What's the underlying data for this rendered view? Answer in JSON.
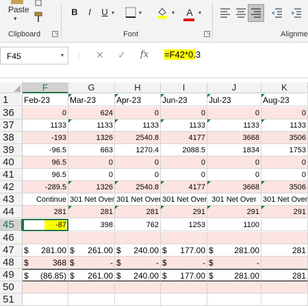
{
  "ribbon": {
    "paste_label": "Paste",
    "clipboard_label": "Clipboard",
    "font_label": "Font",
    "alignment_label": "Alignme",
    "bold": "B",
    "italic": "I",
    "underline": "U",
    "font_color_letter": "A"
  },
  "formula_bar": {
    "name_box": "F45",
    "formula_highlight": "=F42*0.",
    "formula_rest": "3",
    "fx": "fx"
  },
  "columns": [
    "F",
    "G",
    "H",
    "I",
    "J",
    "K"
  ],
  "active_column": "F",
  "rows": [
    {
      "num": "1",
      "cells": [
        "Feb-23",
        "Mar-23",
        "Apr-23",
        "Jun-23",
        "Jul-23",
        "Aug-23"
      ]
    },
    {
      "num": "36",
      "cells": [
        "0",
        "624",
        "0",
        "0",
        "0",
        "0"
      ]
    },
    {
      "num": "37",
      "cells": [
        "1133",
        "1133",
        "1133",
        "1133",
        "1133",
        "1133"
      ]
    },
    {
      "num": "38",
      "cells": [
        "-193",
        "1326",
        "2540.8",
        "4177",
        "3668",
        "3506"
      ]
    },
    {
      "num": "39",
      "cells": [
        "-96.5",
        "663",
        "1270.4",
        "2088.5",
        "1834",
        "1753"
      ]
    },
    {
      "num": "40",
      "cells": [
        "96.5",
        "0",
        "0",
        "0",
        "0",
        "0"
      ]
    },
    {
      "num": "41",
      "cells": [
        "96.5",
        "0",
        "0",
        "0",
        "0",
        "0"
      ]
    },
    {
      "num": "42",
      "cells": [
        "-289.5",
        "1326",
        "2540.8",
        "4177",
        "3668",
        "3506"
      ]
    },
    {
      "num": "43",
      "cells": [
        "Continue",
        "301 Net Over",
        "301 Net Over",
        "301 Net Over",
        "301 Net Over",
        "301 Net Over"
      ]
    },
    {
      "num": "44",
      "cells": [
        "281",
        "281",
        "281",
        "291",
        "291",
        "291"
      ]
    },
    {
      "num": "45",
      "cells": [
        "-87",
        "398",
        "762",
        "1253",
        "1100",
        ""
      ]
    },
    {
      "num": "46",
      "cells": [
        "",
        "",
        "",
        "",
        "",
        ""
      ]
    },
    {
      "num": "47",
      "cells": [
        [
          "$",
          "281.00"
        ],
        [
          "$",
          "261.00"
        ],
        [
          "$",
          "240.00"
        ],
        [
          "$",
          "177.00"
        ],
        [
          "$",
          "281.00"
        ],
        [
          "",
          "281"
        ]
      ]
    },
    {
      "num": "48",
      "cells": [
        [
          "$",
          "368"
        ],
        [
          "$",
          "-"
        ],
        [
          "$",
          "-"
        ],
        [
          "$",
          "-"
        ],
        [
          "$",
          "-"
        ],
        [
          "",
          ""
        ]
      ]
    },
    {
      "num": "49",
      "cells": [
        [
          "$",
          "(86.85)"
        ],
        [
          "$",
          "261.00"
        ],
        [
          "$",
          "240.00"
        ],
        [
          "$",
          "177.00"
        ],
        [
          "$",
          "281.00"
        ],
        [
          "",
          "281"
        ]
      ]
    },
    {
      "num": "50",
      "cells": [
        "",
        "",
        "",
        "",
        "",
        ""
      ]
    },
    {
      "num": "51",
      "cells": [
        "",
        "",
        "",
        "",
        "",
        ""
      ]
    }
  ],
  "active_cell": "F45"
}
